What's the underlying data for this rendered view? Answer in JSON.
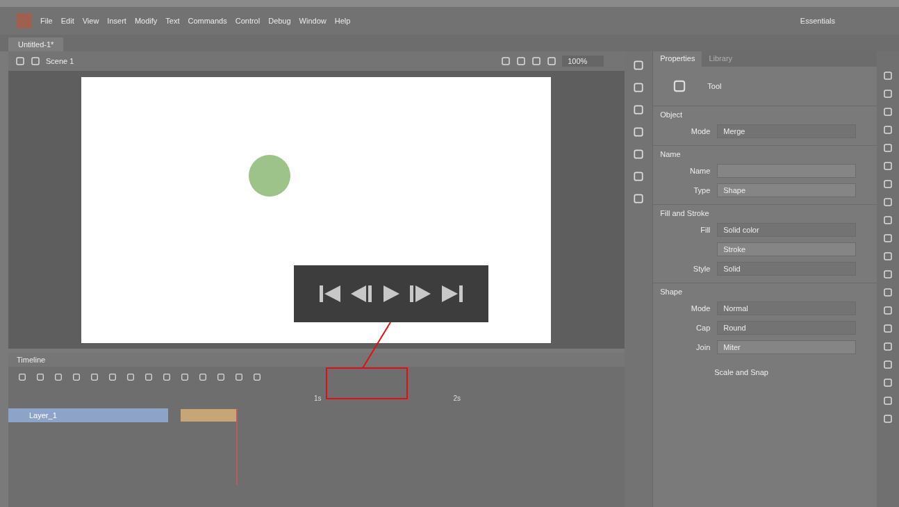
{
  "menu": {
    "items": [
      "File",
      "Edit",
      "View",
      "Insert",
      "Modify",
      "Text",
      "Commands",
      "Control",
      "Debug",
      "Window",
      "Help"
    ],
    "workspace": "Essentials"
  },
  "document_tab": {
    "title": "Untitled-1*"
  },
  "stage_bar": {
    "scene": "Scene 1",
    "zoom": "100%"
  },
  "properties": {
    "tabs": [
      {
        "label": "Properties",
        "selected": true
      },
      {
        "label": "Library",
        "selected": false
      }
    ],
    "heading": "Tool",
    "sections": [
      {
        "title": "Object",
        "rows": [
          {
            "label": "Mode",
            "value": "Merge",
            "kind": "dropdown"
          }
        ]
      },
      {
        "title": "Name",
        "rows": [
          {
            "label": "Name",
            "kind": "field"
          },
          {
            "label": "Type",
            "value": "Shape",
            "kind": "field"
          }
        ]
      },
      {
        "title": "Fill and Stroke",
        "rows": [
          {
            "label": "Fill",
            "value": "Solid color",
            "kind": "dropdown"
          },
          {
            "value": "Stroke",
            "kind": "field"
          },
          {
            "label": "Style",
            "value": "Solid",
            "kind": "dropdown"
          }
        ]
      },
      {
        "title": "Shape",
        "rows": [
          {
            "label": "Mode",
            "value": "Normal",
            "kind": "dropdown"
          },
          {
            "label": "Cap",
            "value": "Round",
            "kind": "dropdown"
          },
          {
            "label": "Join",
            "value": "Miter",
            "kind": "field"
          }
        ]
      }
    ],
    "footer": "Scale and Snap"
  },
  "timeline": {
    "title": "Timeline",
    "ruler": [
      {
        "label": "1s"
      },
      {
        "label": "2s"
      }
    ],
    "layers": [
      {
        "name": "Layer_1",
        "selected": true
      }
    ]
  },
  "playback": [
    {
      "kind": "first"
    },
    {
      "kind": "prev"
    },
    {
      "kind": "play"
    },
    {
      "kind": "next"
    },
    {
      "kind": "last"
    }
  ]
}
